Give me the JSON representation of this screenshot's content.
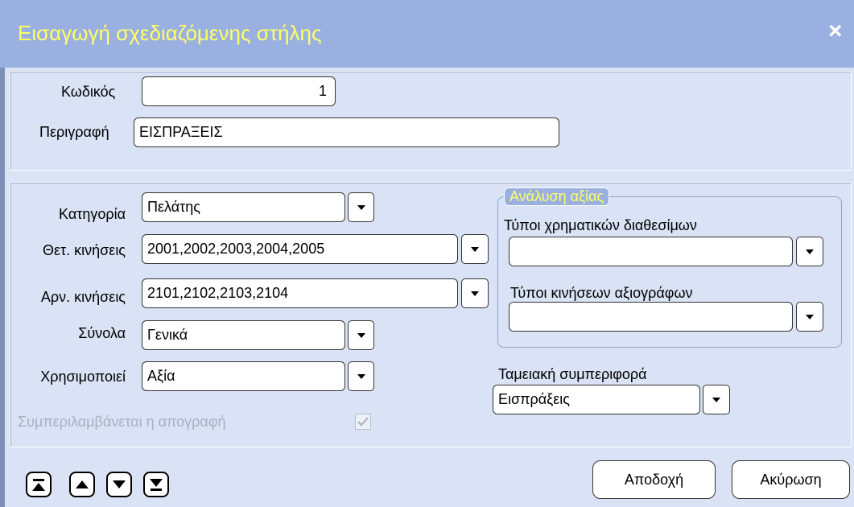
{
  "window": {
    "title": "Εισαγωγή σχεδιαζόμενης στήλης",
    "close_icon": "×"
  },
  "header": {
    "code_label": "Κωδικός",
    "code_value": "1",
    "description_label": "Περιγραφή",
    "description_value": "ΕΙΣΠΡΑΞΕΙΣ"
  },
  "form": {
    "category_label": "Κατηγορία",
    "category_value": "Πελάτης",
    "pos_moves_label": "Θετ. κινήσεις",
    "pos_moves_value": "2001,2002,2003,2004,2005",
    "neg_moves_label": "Αρν. κινήσεις",
    "neg_moves_value": "2101,2102,2103,2104",
    "totals_label": "Σύνολα",
    "totals_value": "Γενικά",
    "uses_label": "Χρησιμοποιεί",
    "uses_value": "Αξία",
    "inventory_label": "Συμπεριλαμβάνεται η απογραφή",
    "inventory_checked": true
  },
  "analysis": {
    "legend": "Ανάλυση αξίας",
    "cash_types_label": "Τύποι χρηματικών διαθεσίμων",
    "cash_types_value": "",
    "securities_label": "Τύποι κινήσεων αξιογράφων",
    "securities_value": ""
  },
  "cash_behavior": {
    "label": "Ταμειακή συμπεριφορά",
    "value": "Εισπράξεις"
  },
  "footer": {
    "accept_label": "Αποδοχή",
    "cancel_label": "Ακύρωση"
  },
  "colors": {
    "titlebar": "#9ab0e0",
    "title_text": "#ffff66",
    "background": "#d9e3f5"
  }
}
